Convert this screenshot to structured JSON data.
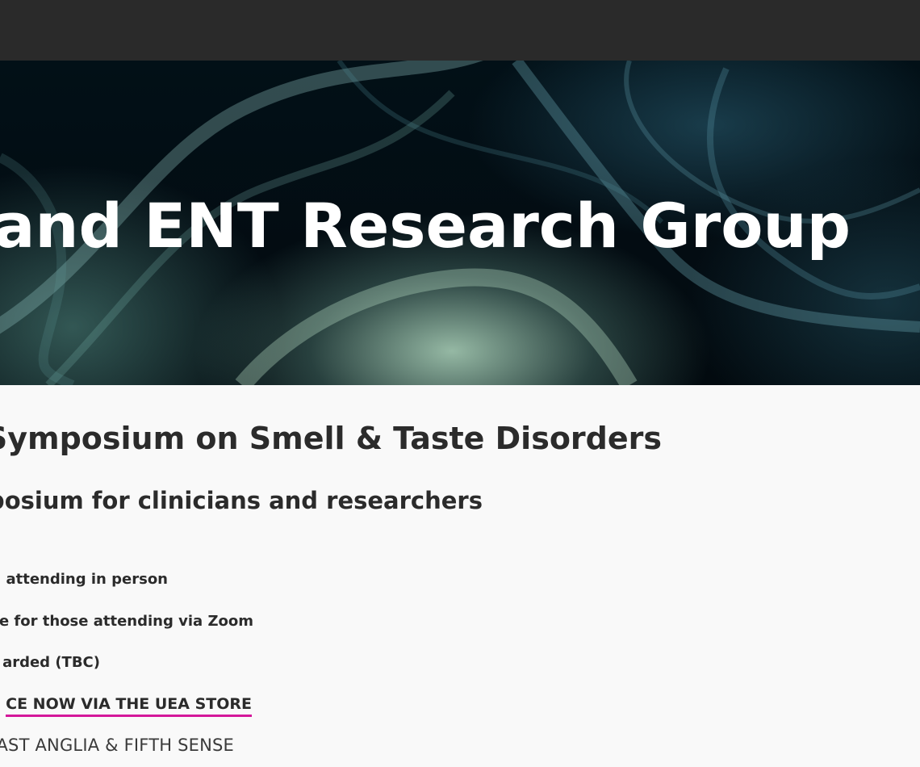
{
  "hero": {
    "title": "ogy and ENT Research Group"
  },
  "main": {
    "heading": "Symposium on Smell & Taste Disorders",
    "subheading": "mposium for clinicians and researchers",
    "info_lines": [
      "attending in person",
      "e for those attending via Zoom",
      "arded (TBC)"
    ],
    "cta_label": "CE NOW VIA THE UEA STORE",
    "organisers": "AST ANGLIA & FIFTH SENSE"
  },
  "colors": {
    "topbar": "#2a2a2a",
    "text": "#2b2b2b",
    "accent_underline": "#d4179a",
    "page_background": "#f9f9f9"
  }
}
